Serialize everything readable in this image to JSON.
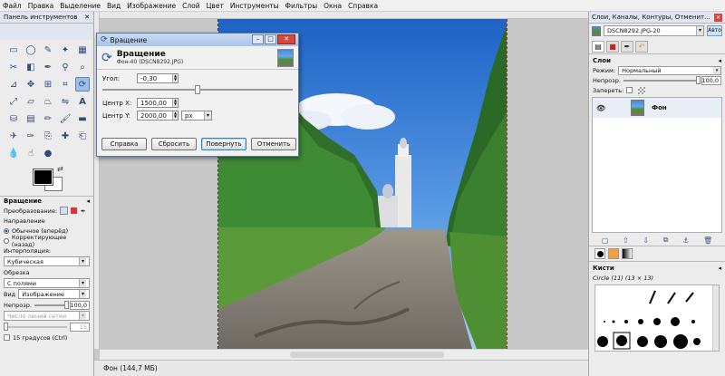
{
  "menu": [
    "Файл",
    "Правка",
    "Выделение",
    "Вид",
    "Изображение",
    "Слой",
    "Цвет",
    "Инструменты",
    "Фильтры",
    "Окна",
    "Справка"
  ],
  "toolbox": {
    "title": "Панель инструментов",
    "tool_options": {
      "title": "Вращение",
      "transform_label": "Преобразование:",
      "direction_label": "Направление",
      "direction_normal": "Обычное (вперёд)",
      "direction_corrective": "Корректирующее (назад)",
      "interpolation_label": "Интерполяция:",
      "interpolation_value": "Кубическая",
      "clipping_label": "Обрезка",
      "clipping_value": "С полями",
      "view_label": "Вид",
      "view_value": "Изображение",
      "opacity_label": "Непрозр.",
      "opacity_value": "100,0",
      "opacity_fraction": 1.0,
      "guides_value": "Число линий сетки",
      "grid_value": "15",
      "step_label": "15 градусов  (Ctrl)"
    }
  },
  "dialog": {
    "title": "Вращение",
    "header_name": "Вращение",
    "header_sub": "Фон-40 (DSCN8292.JPG)",
    "angle_label": "Угол:",
    "angle_value": "-0,30",
    "angle_slider_fraction": 0.5,
    "center_x_label": "Центр X:",
    "center_x_value": "1500,00",
    "center_y_label": "Центр Y:",
    "center_y_value": "2000,00",
    "unit": "px",
    "buttons": {
      "help": "Справка",
      "reset": "Сбросить",
      "rotate": "Повернуть",
      "cancel": "Отменить"
    }
  },
  "status": {
    "text": "Фон (144,7 МБ)"
  },
  "right_panel": {
    "title": "Слои, Каналы, Контуры, Отменит...",
    "image_combo": "DSCN8292.JPG-20",
    "auto_label": "Авто",
    "layers_title": "Слои",
    "mode_label": "Режим:",
    "mode_value": "Нормальный",
    "opacity_label": "Непрозр.",
    "opacity_value": "100,0",
    "opacity_fraction": 1.0,
    "lock_label": "Запереть:",
    "layer_name": "Фон",
    "brushes_title": "Кисти",
    "brush_name": "Circle (11) (13 × 13)"
  },
  "colors": {
    "foreground": "#000000",
    "background": "#ffffff",
    "accent": "#9fc0e6"
  }
}
